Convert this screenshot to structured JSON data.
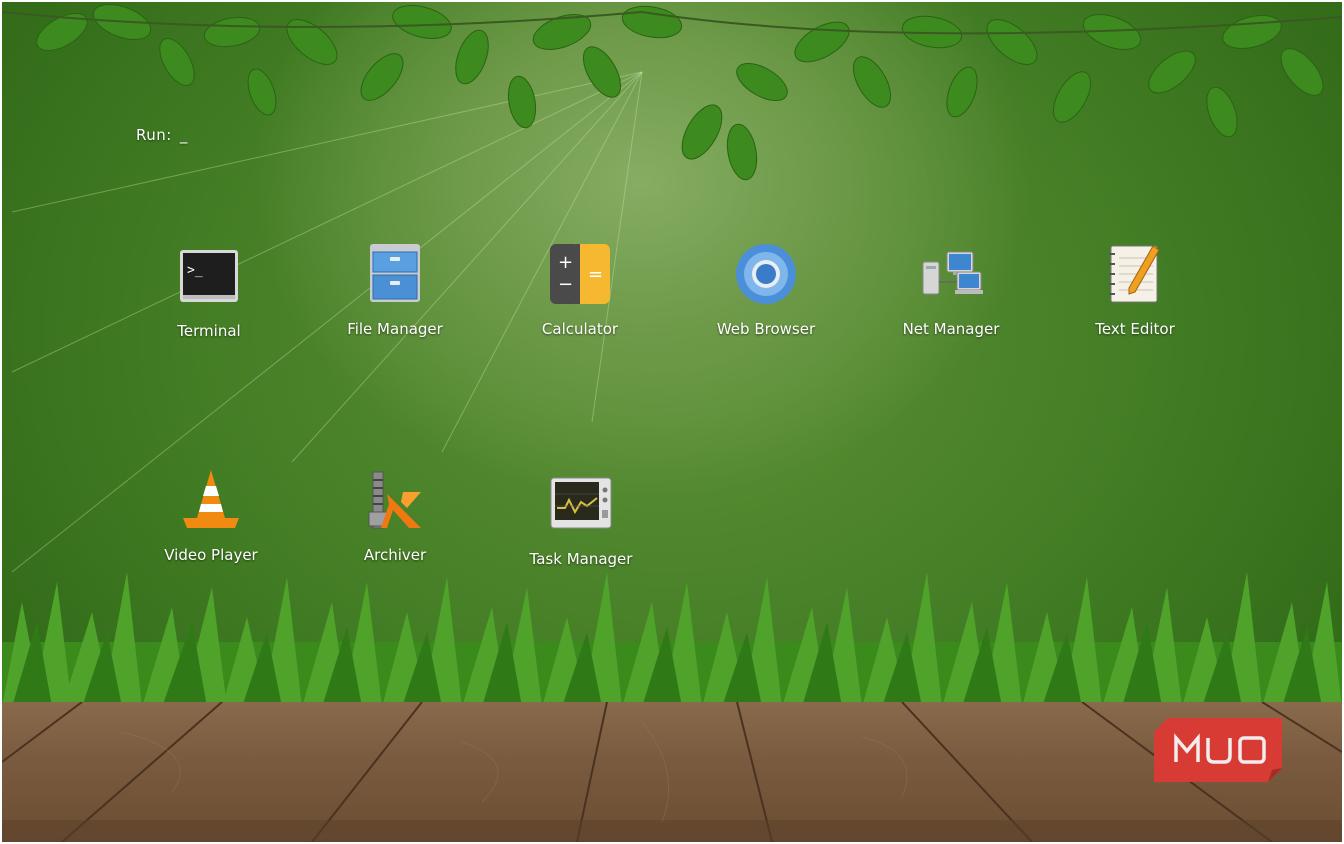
{
  "run": {
    "prompt": "Run:",
    "cursor": "_"
  },
  "apps": [
    {
      "label": "Terminal",
      "icon": "terminal-icon"
    },
    {
      "label": "File Manager",
      "icon": "file-cabinet-icon"
    },
    {
      "label": "Calculator",
      "icon": "calculator-icon"
    },
    {
      "label": "Web Browser",
      "icon": "chromium-browser-icon"
    },
    {
      "label": "Net Manager",
      "icon": "network-computers-icon"
    },
    {
      "label": "Text Editor",
      "icon": "notepad-pencil-icon"
    },
    {
      "label": "Video Player",
      "icon": "traffic-cone-icon"
    },
    {
      "label": "Archiver",
      "icon": "archive-clamp-icon"
    },
    {
      "label": "Task Manager",
      "icon": "system-monitor-icon"
    }
  ],
  "watermark": {
    "text": "MUO",
    "color": "#d83a34"
  },
  "colors": {
    "label": "#ffffff",
    "background": "#4f8a2c",
    "deck": "#7a5b3f"
  }
}
